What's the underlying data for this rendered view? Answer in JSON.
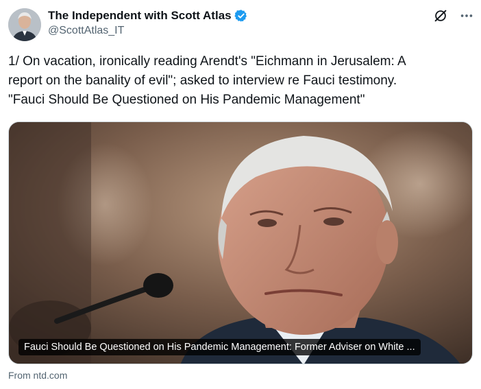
{
  "author": {
    "display_name": "The Independent with Scott Atlas",
    "handle": "@ScottAtlas_IT",
    "verified": true,
    "verified_color": "#1d9bf0",
    "avatar_icon": "avatar-portrait"
  },
  "actions": {
    "grok_icon": "grok-icon",
    "more_icon": "more-icon"
  },
  "tweet": {
    "lines": [
      "1/ On vacation, ironically reading Arendt's \"Eichmann in Jerusalem: A",
      "report on the banality of evil\"; asked to interview re Fauci testimony.",
      "\"Fauci Should Be Questioned on His Pandemic Management\""
    ]
  },
  "card": {
    "title": "Fauci Should Be Questioned on His Pandemic Management: Former Adviser on White ...",
    "source_label": "From ntd.com"
  }
}
